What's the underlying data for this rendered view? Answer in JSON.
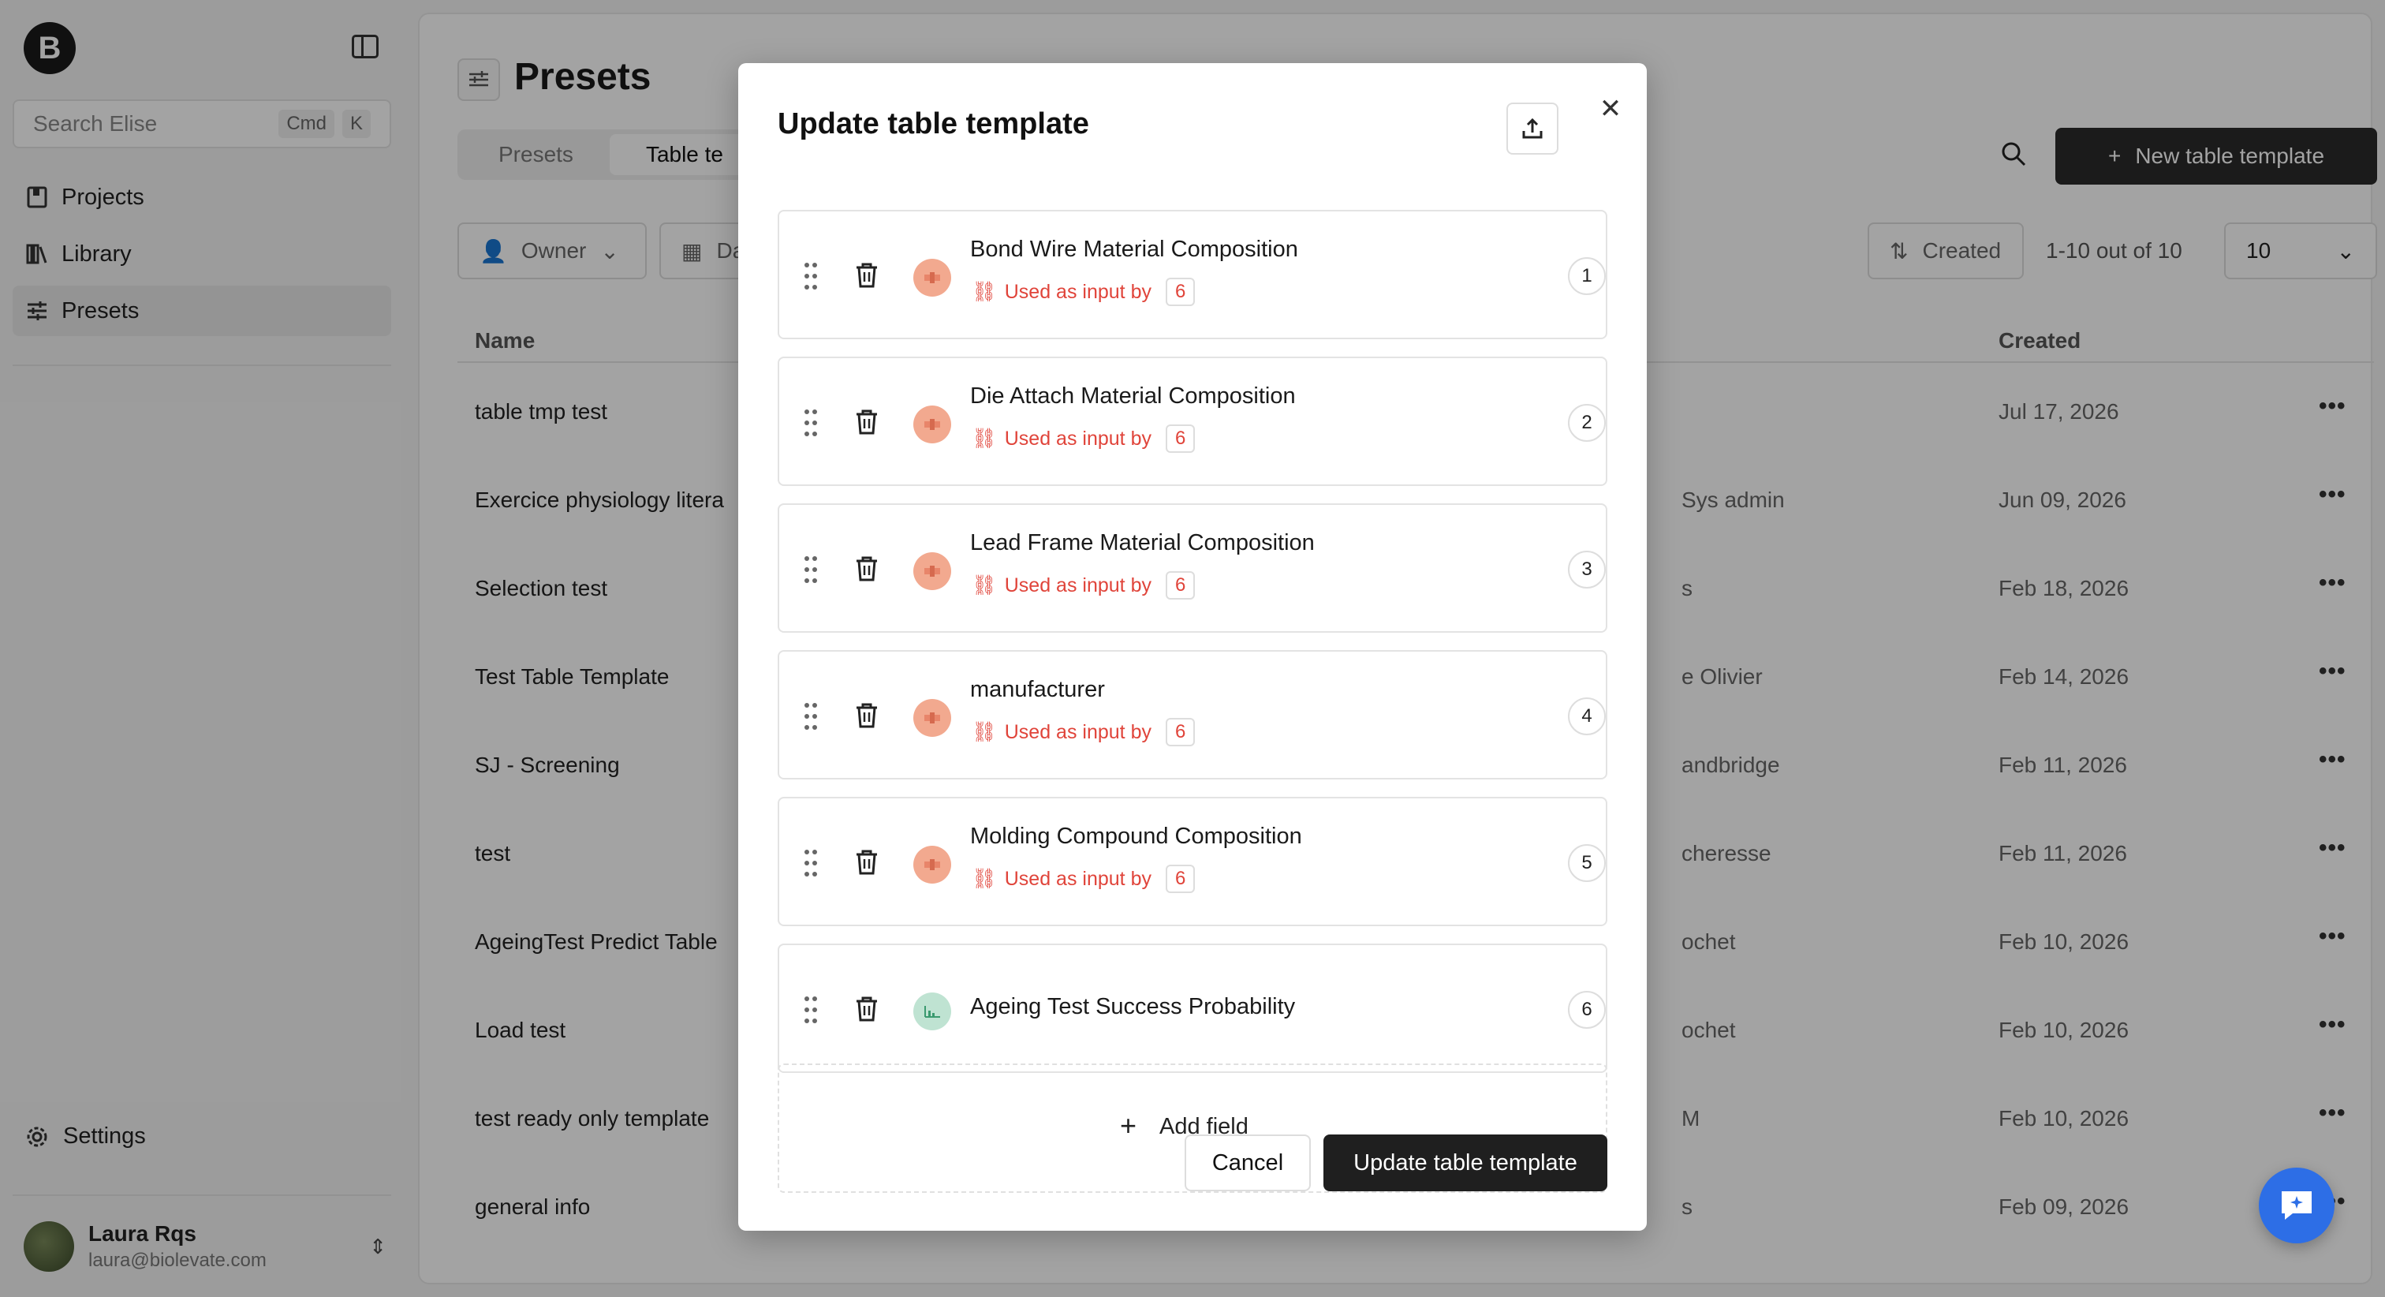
{
  "sidebar": {
    "logo_letter": "B",
    "search": {
      "placeholder": "Search Elise",
      "kbd_1": "Cmd",
      "kbd_2": "K"
    },
    "items": [
      {
        "label": "Projects",
        "icon": "book-icon"
      },
      {
        "label": "Library",
        "icon": "library-icon"
      },
      {
        "label": "Presets",
        "icon": "sliders-icon",
        "active": true
      }
    ],
    "settings_label": "Settings",
    "user": {
      "name": "Laura Rqs",
      "email": "laura@biolevate.com"
    }
  },
  "main": {
    "title": "Presets",
    "tabs": [
      {
        "label": "Presets"
      },
      {
        "label": "Table te",
        "active": true
      }
    ],
    "new_button_label": "New table template",
    "filters": {
      "owner": "Owner",
      "date": "Da",
      "sort": "Created"
    },
    "pagination": {
      "text": "1-10  out of  10",
      "page_size": "10"
    },
    "columns": {
      "name": "Name",
      "created": "Created"
    },
    "rows": [
      {
        "name": "table tmp test",
        "owner": "",
        "created": "Jul 17, 2026"
      },
      {
        "name": "Exercice physiology litera",
        "owner": "Sys admin",
        "created": "Jun 09, 2026"
      },
      {
        "name": "Selection test",
        "owner": "s",
        "created": "Feb 18, 2026"
      },
      {
        "name": "Test Table Template",
        "owner": "e Olivier",
        "created": "Feb 14, 2026"
      },
      {
        "name": "SJ - Screening",
        "owner": "andbridge",
        "created": "Feb 11, 2026"
      },
      {
        "name": "test",
        "owner": "cheresse",
        "created": "Feb 11, 2026"
      },
      {
        "name": "AgeingTest Predict Table",
        "owner": "ochet",
        "created": "Feb 10, 2026"
      },
      {
        "name": "Load test",
        "owner": "ochet",
        "created": "Feb 10, 2026"
      },
      {
        "name": "test ready only template",
        "owner": "M",
        "created": "Feb 10, 2026"
      },
      {
        "name": "general info",
        "owner": "s",
        "created": "Feb 09, 2026"
      }
    ],
    "row_menu_glyph": "•••"
  },
  "modal": {
    "title": "Update table template",
    "fields": [
      {
        "name": "Bond Wire Material Composition",
        "order": "1",
        "used_label": "Used as input by",
        "used_count": "6",
        "type_color": "orange"
      },
      {
        "name": "Die Attach Material Composition",
        "order": "2",
        "used_label": "Used as input by",
        "used_count": "6",
        "type_color": "orange"
      },
      {
        "name": "Lead Frame Material Composition",
        "order": "3",
        "used_label": "Used as input by",
        "used_count": "6",
        "type_color": "orange"
      },
      {
        "name": "manufacturer",
        "order": "4",
        "used_label": "Used as input by",
        "used_count": "6",
        "type_color": "orange"
      },
      {
        "name": "Molding Compound Composition",
        "order": "5",
        "used_label": "Used as input by",
        "used_count": "6",
        "type_color": "orange"
      },
      {
        "name": "Ageing Test Success Probability",
        "order": "6",
        "type_color": "green"
      }
    ],
    "add_field_label": "Add field",
    "cancel_label": "Cancel",
    "submit_label": "Update table template"
  },
  "colors": {
    "accent_red": "#e0443a",
    "dark_button": "#1f1f1f",
    "fab_blue": "#2d6ee6"
  }
}
